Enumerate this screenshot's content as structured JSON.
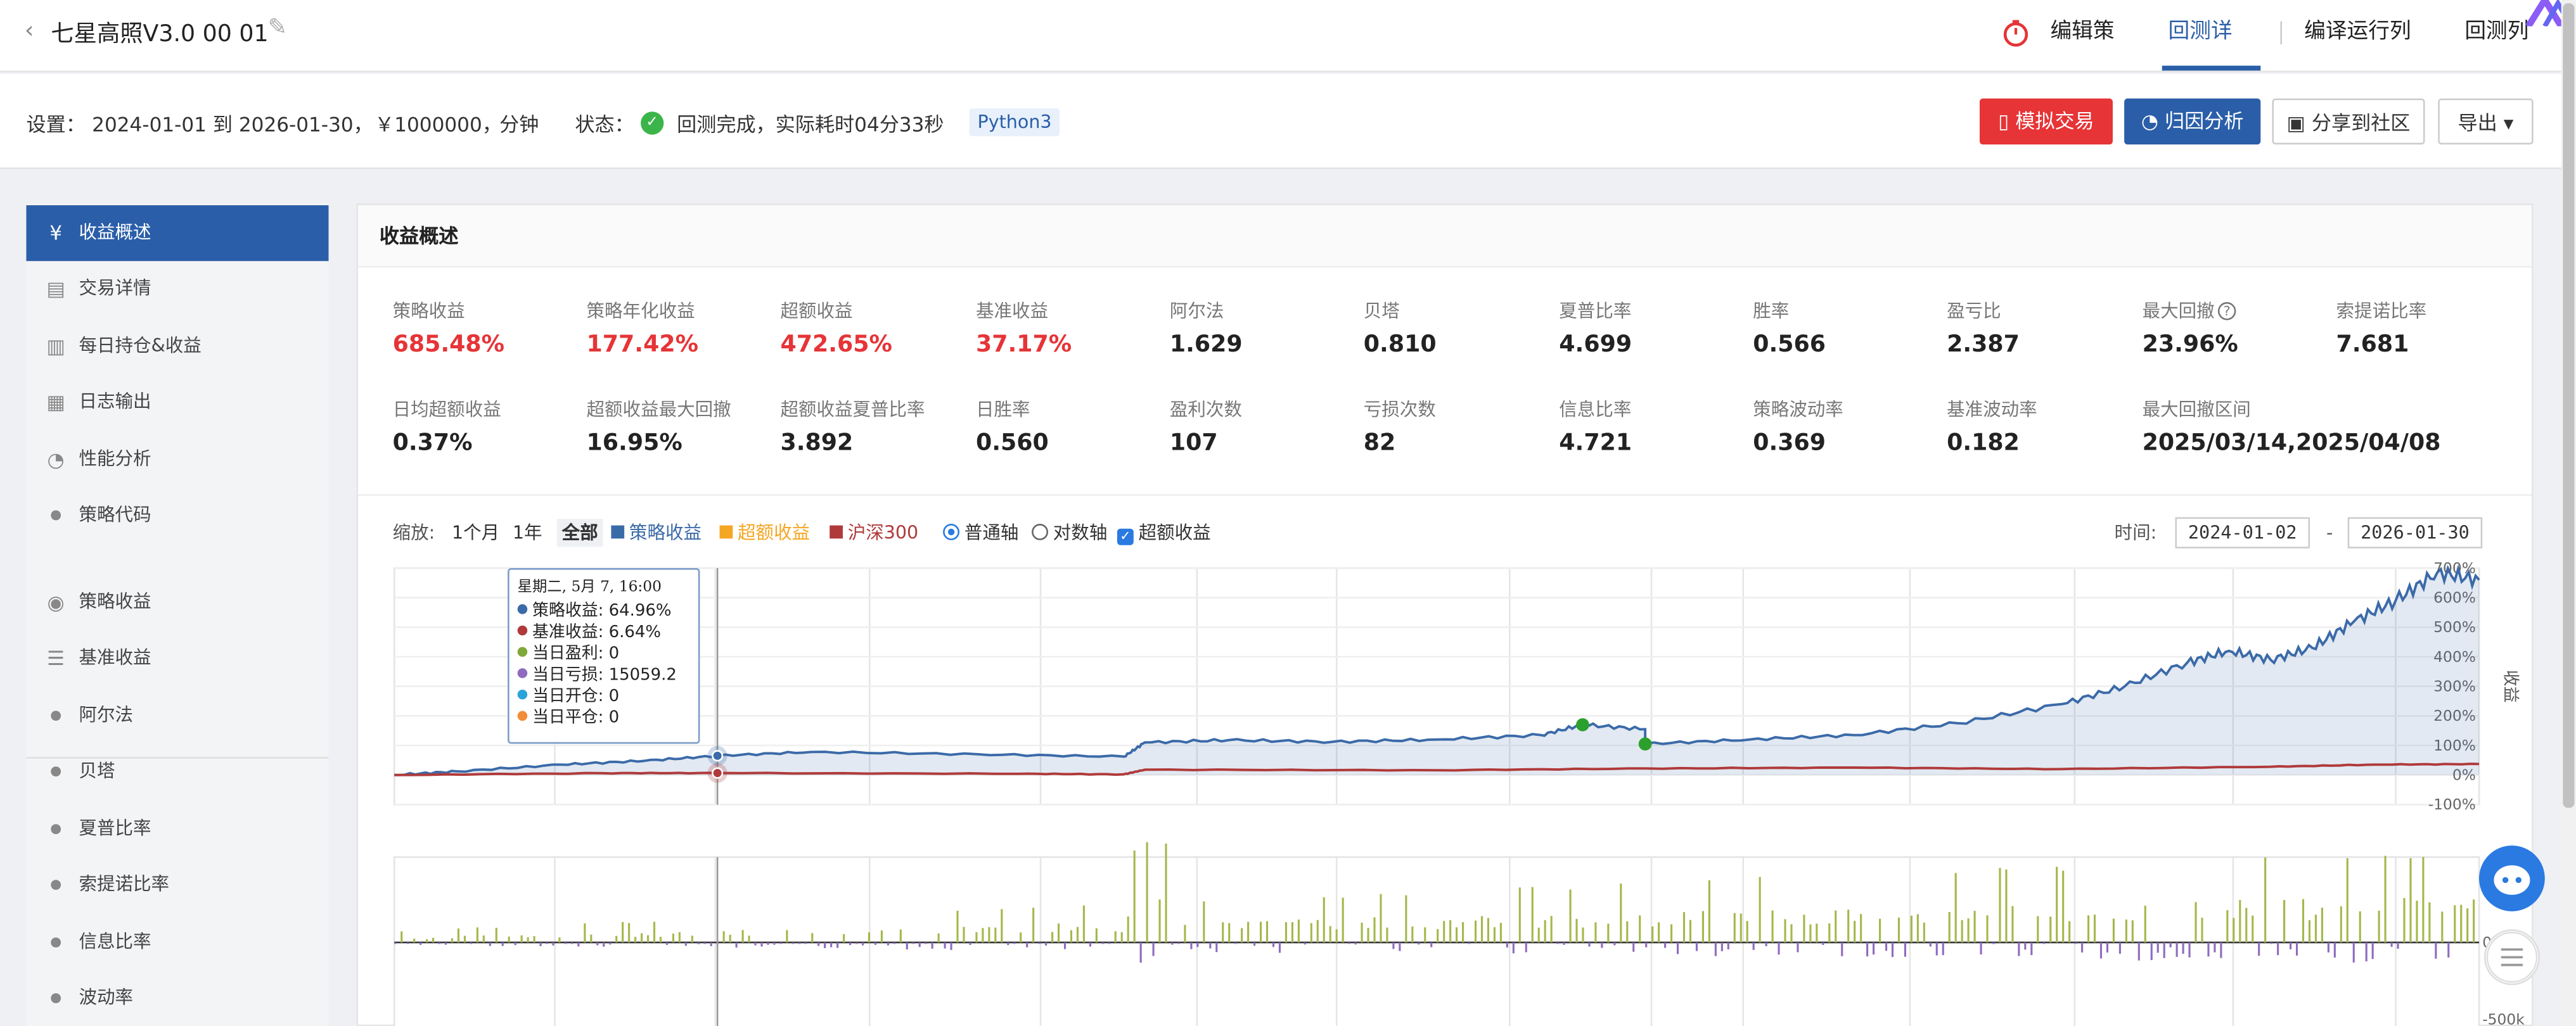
{
  "header": {
    "title": "七星高照V3.0 00 01",
    "nav": [
      "编辑策略",
      "回测详情",
      "编译运行列表",
      "回测列表"
    ]
  },
  "settings": {
    "label": "设置：",
    "period": "2024-01-01 到 2026-01-30，",
    "capital": "￥1000000，",
    "freq": "分钟",
    "status_label": "状态：",
    "status_text": "回测完成，实际耗时04分33秒",
    "lang_badge": "Python3"
  },
  "actions": {
    "simulate": "模拟交易",
    "attribution": "归因分析",
    "share": "分享到社区",
    "export": "导出"
  },
  "sidebar": {
    "items": [
      "收益概述",
      "交易详情",
      "每日持仓&收益",
      "日志输出",
      "性能分析",
      "策略代码",
      "策略收益",
      "基准收益",
      "阿尔法",
      "贝塔",
      "夏普比率",
      "索提诺比率",
      "信息比率",
      "波动率"
    ]
  },
  "panel": {
    "title": "收益概述"
  },
  "metrics": [
    {
      "label": "策略收益",
      "value": "685.48%"
    },
    {
      "label": "策略年化收益",
      "value": "177.42%"
    },
    {
      "label": "超额收益",
      "value": "472.65%"
    },
    {
      "label": "基准收益",
      "value": "37.17%"
    },
    {
      "label": "阿尔法",
      "value": "1.629"
    },
    {
      "label": "贝塔",
      "value": "0.810"
    },
    {
      "label": "夏普比率",
      "value": "4.699"
    },
    {
      "label": "胜率",
      "value": "0.566"
    },
    {
      "label": "盈亏比",
      "value": "2.387"
    },
    {
      "label": "最大回撤",
      "value": "23.96%"
    },
    {
      "label": "索提诺比率",
      "value": "7.681"
    },
    {
      "label": "日均超额收益",
      "value": "0.37%"
    },
    {
      "label": "超额收益最大回撤",
      "value": "16.95%"
    },
    {
      "label": "超额收益夏普比率",
      "value": "3.892"
    },
    {
      "label": "日胜率",
      "value": "0.560"
    },
    {
      "label": "盈利次数",
      "value": "107"
    },
    {
      "label": "亏损次数",
      "value": "82"
    },
    {
      "label": "信息比率",
      "value": "4.721"
    },
    {
      "label": "策略波动率",
      "value": "0.369"
    },
    {
      "label": "基准波动率",
      "value": "0.182"
    },
    {
      "label": "最大回撤区间",
      "value": "2025/03/14,2025/04/08"
    }
  ],
  "chart_controls": {
    "zoom_label": "缩放:",
    "zoom_options": [
      "1个月",
      "1年",
      "全部"
    ],
    "zoom_selected": "全部",
    "series_toggles": [
      "策略收益",
      "超额收益",
      "沪深300"
    ],
    "axis_options": [
      "普通轴",
      "对数轴"
    ],
    "axis_selected": "普通轴",
    "excess_checkbox": "超额收益",
    "time_label": "时间:",
    "date_from": "2024-01-02",
    "date_to": "2026-01-30",
    "date_sep": "-"
  },
  "tooltip": {
    "title": "星期二, 5月 7, 16:00",
    "rows": [
      "策略收益: 64.96%",
      "基准收益: 6.64%",
      "当日盈利: 0",
      "当日亏损: 15059.2",
      "当日开仓: 0",
      "当日平仓: 0"
    ],
    "colors": [
      "#3b6aa8",
      "#b03a3a",
      "#7fa83a",
      "#8e6bbf",
      "#2ba3d9",
      "#f28c38"
    ]
  },
  "colors": {
    "accent": "#2a5ea8",
    "danger": "#e63437",
    "strategy": "#3b6aa8",
    "benchmark": "#b03a3a",
    "excess": "#f5a623",
    "profit_bar": "#a4b84a",
    "loss_bar": "#8e6bbf"
  },
  "chart_data": [
    {
      "type": "line",
      "ylabel": "收益",
      "yticks": [
        "700%",
        "600%",
        "500%",
        "400%",
        "300%",
        "200%",
        "100%",
        "0%",
        "-100%"
      ],
      "ylim": [
        -100,
        700
      ],
      "grid": true,
      "x_range": [
        "2024-01-02",
        "2026-01-30"
      ],
      "series": [
        {
          "name": "策略收益",
          "points": [
            [
              0,
              0
            ],
            [
              0.03,
              12
            ],
            [
              0.08,
              35
            ],
            [
              0.12,
              48
            ],
            [
              0.155,
              64.96
            ],
            [
              0.2,
              78
            ],
            [
              0.28,
              70
            ],
            [
              0.35,
              62
            ],
            [
              0.36,
              110
            ],
            [
              0.4,
              118
            ],
            [
              0.45,
              112
            ],
            [
              0.5,
              120
            ],
            [
              0.55,
              135
            ],
            [
              0.57,
              170
            ],
            [
              0.6,
              155
            ],
            [
              0.6,
              105
            ],
            [
              0.65,
              120
            ],
            [
              0.7,
              135
            ],
            [
              0.75,
              175
            ],
            [
              0.8,
              240
            ],
            [
              0.83,
              300
            ],
            [
              0.86,
              380
            ],
            [
              0.88,
              420
            ],
            [
              0.9,
              390
            ],
            [
              0.92,
              430
            ],
            [
              0.94,
              520
            ],
            [
              0.96,
              590
            ],
            [
              0.98,
              685.48
            ],
            [
              1.0,
              660
            ]
          ]
        },
        {
          "name": "沪深300",
          "points": [
            [
              0,
              0
            ],
            [
              0.1,
              6
            ],
            [
              0.155,
              6.64
            ],
            [
              0.3,
              4
            ],
            [
              0.35,
              2
            ],
            [
              0.36,
              18
            ],
            [
              0.5,
              16
            ],
            [
              0.6,
              22
            ],
            [
              0.7,
              25
            ],
            [
              0.8,
              20
            ],
            [
              0.9,
              28
            ],
            [
              0.95,
              35
            ],
            [
              1.0,
              37.17
            ]
          ]
        }
      ],
      "markers": [
        {
          "x": 0.57,
          "y": 170,
          "color": "#2ca02c"
        },
        {
          "x": 0.6,
          "y": 105,
          "color": "#2ca02c"
        }
      ]
    },
    {
      "type": "bar",
      "yticks": [
        "0k",
        "-500k"
      ],
      "series": [
        {
          "name": "当日盈利"
        },
        {
          "name": "当日亏损"
        }
      ]
    }
  ]
}
